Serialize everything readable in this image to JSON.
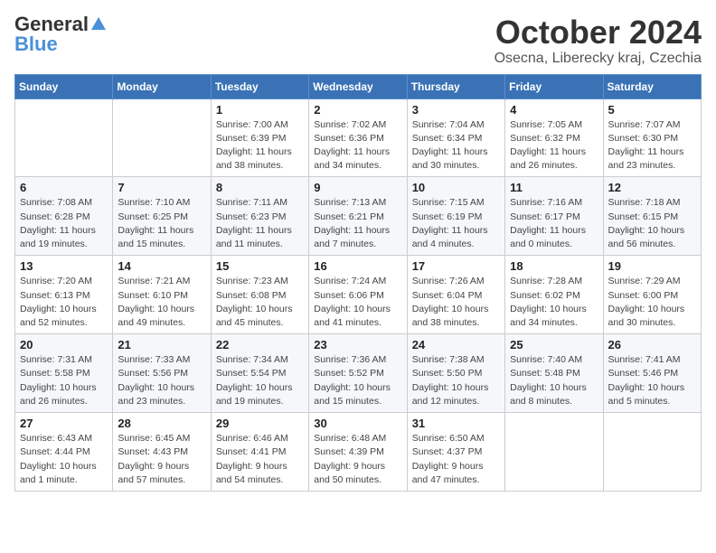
{
  "logo": {
    "general": "General",
    "blue": "Blue"
  },
  "title": {
    "month": "October 2024",
    "location": "Osecna, Liberecky kraj, Czechia"
  },
  "weekdays": [
    "Sunday",
    "Monday",
    "Tuesday",
    "Wednesday",
    "Thursday",
    "Friday",
    "Saturday"
  ],
  "weeks": [
    [
      {
        "day": "",
        "detail": ""
      },
      {
        "day": "",
        "detail": ""
      },
      {
        "day": "1",
        "detail": "Sunrise: 7:00 AM\nSunset: 6:39 PM\nDaylight: 11 hours and 38 minutes."
      },
      {
        "day": "2",
        "detail": "Sunrise: 7:02 AM\nSunset: 6:36 PM\nDaylight: 11 hours and 34 minutes."
      },
      {
        "day": "3",
        "detail": "Sunrise: 7:04 AM\nSunset: 6:34 PM\nDaylight: 11 hours and 30 minutes."
      },
      {
        "day": "4",
        "detail": "Sunrise: 7:05 AM\nSunset: 6:32 PM\nDaylight: 11 hours and 26 minutes."
      },
      {
        "day": "5",
        "detail": "Sunrise: 7:07 AM\nSunset: 6:30 PM\nDaylight: 11 hours and 23 minutes."
      }
    ],
    [
      {
        "day": "6",
        "detail": "Sunrise: 7:08 AM\nSunset: 6:28 PM\nDaylight: 11 hours and 19 minutes."
      },
      {
        "day": "7",
        "detail": "Sunrise: 7:10 AM\nSunset: 6:25 PM\nDaylight: 11 hours and 15 minutes."
      },
      {
        "day": "8",
        "detail": "Sunrise: 7:11 AM\nSunset: 6:23 PM\nDaylight: 11 hours and 11 minutes."
      },
      {
        "day": "9",
        "detail": "Sunrise: 7:13 AM\nSunset: 6:21 PM\nDaylight: 11 hours and 7 minutes."
      },
      {
        "day": "10",
        "detail": "Sunrise: 7:15 AM\nSunset: 6:19 PM\nDaylight: 11 hours and 4 minutes."
      },
      {
        "day": "11",
        "detail": "Sunrise: 7:16 AM\nSunset: 6:17 PM\nDaylight: 11 hours and 0 minutes."
      },
      {
        "day": "12",
        "detail": "Sunrise: 7:18 AM\nSunset: 6:15 PM\nDaylight: 10 hours and 56 minutes."
      }
    ],
    [
      {
        "day": "13",
        "detail": "Sunrise: 7:20 AM\nSunset: 6:13 PM\nDaylight: 10 hours and 52 minutes."
      },
      {
        "day": "14",
        "detail": "Sunrise: 7:21 AM\nSunset: 6:10 PM\nDaylight: 10 hours and 49 minutes."
      },
      {
        "day": "15",
        "detail": "Sunrise: 7:23 AM\nSunset: 6:08 PM\nDaylight: 10 hours and 45 minutes."
      },
      {
        "day": "16",
        "detail": "Sunrise: 7:24 AM\nSunset: 6:06 PM\nDaylight: 10 hours and 41 minutes."
      },
      {
        "day": "17",
        "detail": "Sunrise: 7:26 AM\nSunset: 6:04 PM\nDaylight: 10 hours and 38 minutes."
      },
      {
        "day": "18",
        "detail": "Sunrise: 7:28 AM\nSunset: 6:02 PM\nDaylight: 10 hours and 34 minutes."
      },
      {
        "day": "19",
        "detail": "Sunrise: 7:29 AM\nSunset: 6:00 PM\nDaylight: 10 hours and 30 minutes."
      }
    ],
    [
      {
        "day": "20",
        "detail": "Sunrise: 7:31 AM\nSunset: 5:58 PM\nDaylight: 10 hours and 26 minutes."
      },
      {
        "day": "21",
        "detail": "Sunrise: 7:33 AM\nSunset: 5:56 PM\nDaylight: 10 hours and 23 minutes."
      },
      {
        "day": "22",
        "detail": "Sunrise: 7:34 AM\nSunset: 5:54 PM\nDaylight: 10 hours and 19 minutes."
      },
      {
        "day": "23",
        "detail": "Sunrise: 7:36 AM\nSunset: 5:52 PM\nDaylight: 10 hours and 15 minutes."
      },
      {
        "day": "24",
        "detail": "Sunrise: 7:38 AM\nSunset: 5:50 PM\nDaylight: 10 hours and 12 minutes."
      },
      {
        "day": "25",
        "detail": "Sunrise: 7:40 AM\nSunset: 5:48 PM\nDaylight: 10 hours and 8 minutes."
      },
      {
        "day": "26",
        "detail": "Sunrise: 7:41 AM\nSunset: 5:46 PM\nDaylight: 10 hours and 5 minutes."
      }
    ],
    [
      {
        "day": "27",
        "detail": "Sunrise: 6:43 AM\nSunset: 4:44 PM\nDaylight: 10 hours and 1 minute."
      },
      {
        "day": "28",
        "detail": "Sunrise: 6:45 AM\nSunset: 4:43 PM\nDaylight: 9 hours and 57 minutes."
      },
      {
        "day": "29",
        "detail": "Sunrise: 6:46 AM\nSunset: 4:41 PM\nDaylight: 9 hours and 54 minutes."
      },
      {
        "day": "30",
        "detail": "Sunrise: 6:48 AM\nSunset: 4:39 PM\nDaylight: 9 hours and 50 minutes."
      },
      {
        "day": "31",
        "detail": "Sunrise: 6:50 AM\nSunset: 4:37 PM\nDaylight: 9 hours and 47 minutes."
      },
      {
        "day": "",
        "detail": ""
      },
      {
        "day": "",
        "detail": ""
      }
    ]
  ]
}
